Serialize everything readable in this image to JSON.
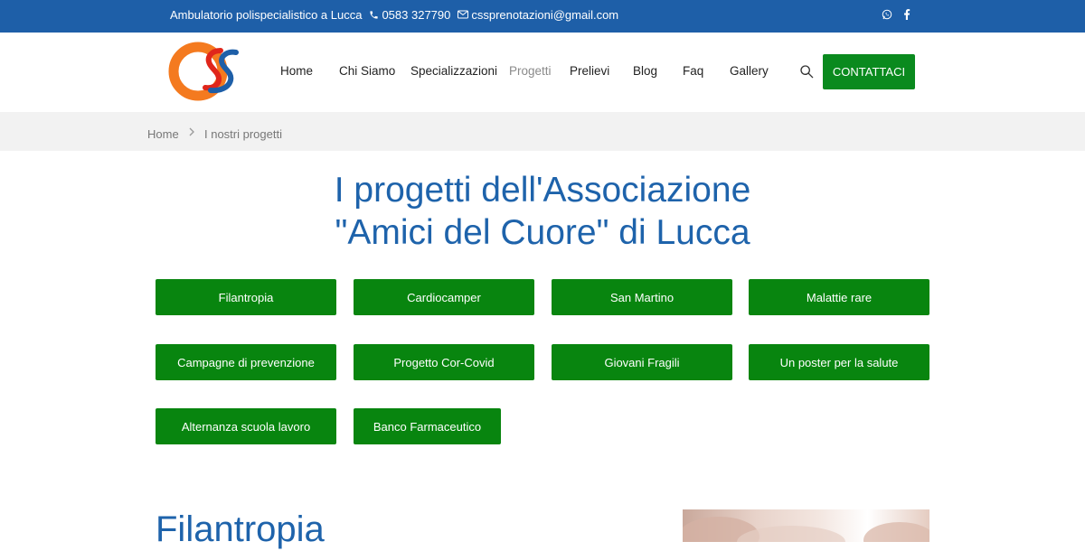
{
  "topbar": {
    "tagline": "Ambulatorio polispecialistico a Lucca",
    "phone": "0583 327790",
    "email": "cssprenotazioni@gmail.com",
    "social_icons": [
      "whatsapp-icon",
      "facebook-icon"
    ]
  },
  "header": {
    "logo_icon": "heart-logo-icon",
    "nav": [
      "Home",
      "Chi Siamo",
      "Specializzazioni",
      "Progetti",
      "Prelievi",
      "Blog",
      "Faq",
      "Gallery"
    ],
    "active_nav": "Progetti",
    "search_icon": "search-icon",
    "contact_label": "CONTATTACI"
  },
  "breadcrumb": {
    "home": "Home",
    "current": "I nostri progetti"
  },
  "page": {
    "title_line1": "I progetti dell'Associazione",
    "title_line2": "\"Amici del Cuore\" di Lucca"
  },
  "projects": [
    "Filantropia",
    "Cardiocamper",
    "San Martino",
    "Malattie rare",
    "Campagne di prevenzione",
    "Progetto Cor-Covid",
    "Giovani Fragili",
    "Un poster per la salute",
    "Alternanza scuola lavoro",
    "Banco Farmaceutico"
  ],
  "section": {
    "title": "Filantropia"
  },
  "colors": {
    "brand_blue": "#1e5fa8",
    "button_green": "#08850f",
    "logo_orange": "#f47a1f",
    "logo_red": "#e0261b"
  }
}
